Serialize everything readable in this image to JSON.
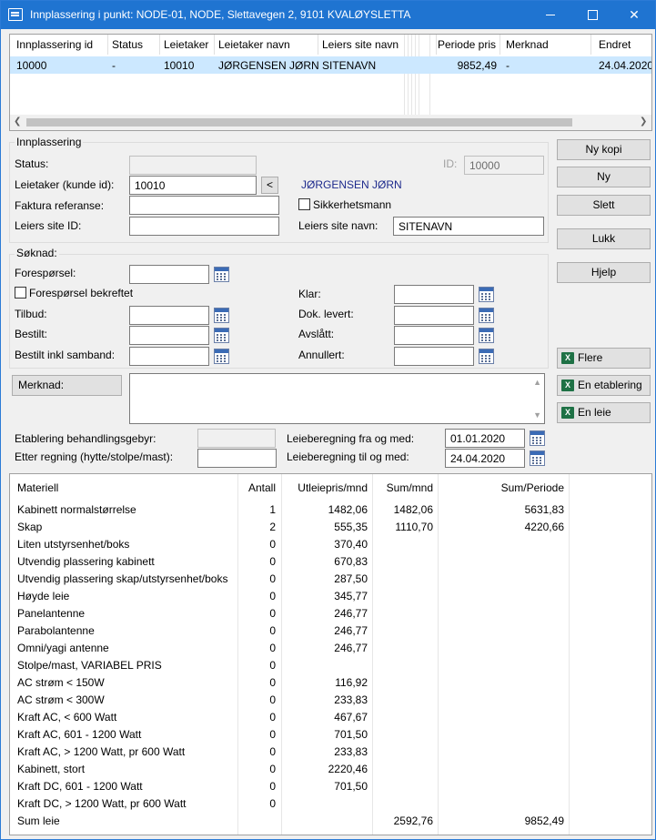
{
  "window": {
    "title": "Innplassering i punkt: NODE-01, NODE, Slettavegen 2, 9101 KVALØYSLETTA"
  },
  "top_table": {
    "columns": [
      "Innplassering id",
      "Status",
      "Leietaker",
      "Leietaker navn",
      "Leiers site navn",
      "Periode pris",
      "Merknad",
      "Endret"
    ],
    "row": {
      "id": "10000",
      "status": "-",
      "leietaker": "10010",
      "leietaker_navn": "JØRGENSEN JØRN",
      "site_navn": "SITENAVN",
      "periode_pris": "9852,49",
      "merknad": "-",
      "endret": "24.04.2020"
    }
  },
  "innplassering": {
    "title": "Innplassering",
    "status_label": "Status:",
    "status_value": "",
    "id_label": "ID:",
    "id_value": "10000",
    "leietaker_label": "Leietaker (kunde id):",
    "leietaker_value": "10010",
    "lookup_button": "<",
    "leietaker_name": "JØRGENSEN JØRN",
    "faktura_label": "Faktura referanse:",
    "faktura_value": "",
    "sikkerhetsmann_label": "Sikkerhetsmann",
    "site_id_label": "Leiers site ID:",
    "site_id_value": "",
    "site_navn_label": "Leiers site navn:",
    "site_navn_value": "SITENAVN"
  },
  "soknad": {
    "title": "Søknad:",
    "foresporsel_label": "Forespørsel:",
    "foresporsel_bekreftet_label": "Forespørsel bekreftet",
    "tilbud_label": "Tilbud:",
    "bestilt_label": "Bestilt:",
    "bestilt_samband_label": "Bestilt inkl samband:",
    "klar_label": "Klar:",
    "dok_levert_label": "Dok. levert:",
    "avslatt_label": "Avslått:",
    "annullert_label": "Annullert:"
  },
  "merknad": {
    "label": "Merknad:",
    "value": ""
  },
  "gebyr": {
    "etablering_label": "Etablering behandlingsgebyr:",
    "etter_regning_label": "Etter regning (hytte/stolpe/mast):",
    "fra_label": "Leieberegning fra og med:",
    "fra_value": "01.01.2020",
    "til_label": "Leieberegning til og med:",
    "til_value": "24.04.2020"
  },
  "buttons": {
    "ny_kopi": "Ny kopi",
    "ny": "Ny",
    "slett": "Slett",
    "lukk": "Lukk",
    "hjelp": "Hjelp",
    "flere": "Flere",
    "en_etablering": "En etablering",
    "en_leie": "En leie",
    "excel_glyph": "X"
  },
  "material_table": {
    "columns": [
      "Materiell",
      "Antall",
      "Utleiepris/mnd",
      "Sum/mnd",
      "Sum/Periode"
    ],
    "rows": [
      [
        "Kabinett normalstørrelse",
        "1",
        "1482,06",
        "1482,06",
        "5631,83"
      ],
      [
        "Skap",
        "2",
        "555,35",
        "1110,70",
        "4220,66"
      ],
      [
        "Liten utstyrsenhet/boks",
        "0",
        "370,40",
        "",
        ""
      ],
      [
        "Utvendig plassering kabinett",
        "0",
        "670,83",
        "",
        ""
      ],
      [
        "Utvendig plassering skap/utstyrsenhet/boks",
        "0",
        "287,50",
        "",
        ""
      ],
      [
        "Høyde leie",
        "0",
        "345,77",
        "",
        ""
      ],
      [
        "Panelantenne",
        "0",
        "246,77",
        "",
        ""
      ],
      [
        "Parabolantenne",
        "0",
        "246,77",
        "",
        ""
      ],
      [
        "Omni/yagi antenne",
        "0",
        "246,77",
        "",
        ""
      ],
      [
        "Stolpe/mast, VARIABEL PRIS",
        "0",
        "",
        "",
        ""
      ],
      [
        "AC strøm < 150W",
        "0",
        "116,92",
        "",
        ""
      ],
      [
        "AC strøm < 300W",
        "0",
        "233,83",
        "",
        ""
      ],
      [
        "Kraft AC, < 600 Watt",
        "0",
        "467,67",
        "",
        ""
      ],
      [
        "Kraft AC, 601 - 1200 Watt",
        "0",
        "701,50",
        "",
        ""
      ],
      [
        "Kraft AC, > 1200 Watt, pr 600 Watt",
        "0",
        "233,83",
        "",
        ""
      ],
      [
        "Kabinett, stort",
        "0",
        "2220,46",
        "",
        ""
      ],
      [
        "Kraft DC, 601 - 1200 Watt",
        "0",
        "701,50",
        "",
        ""
      ],
      [
        "Kraft DC, > 1200 Watt, pr 600 Watt",
        "0",
        "",
        "",
        ""
      ],
      [
        "Sum leie",
        "",
        "",
        "2592,76",
        "9852,49"
      ]
    ]
  }
}
